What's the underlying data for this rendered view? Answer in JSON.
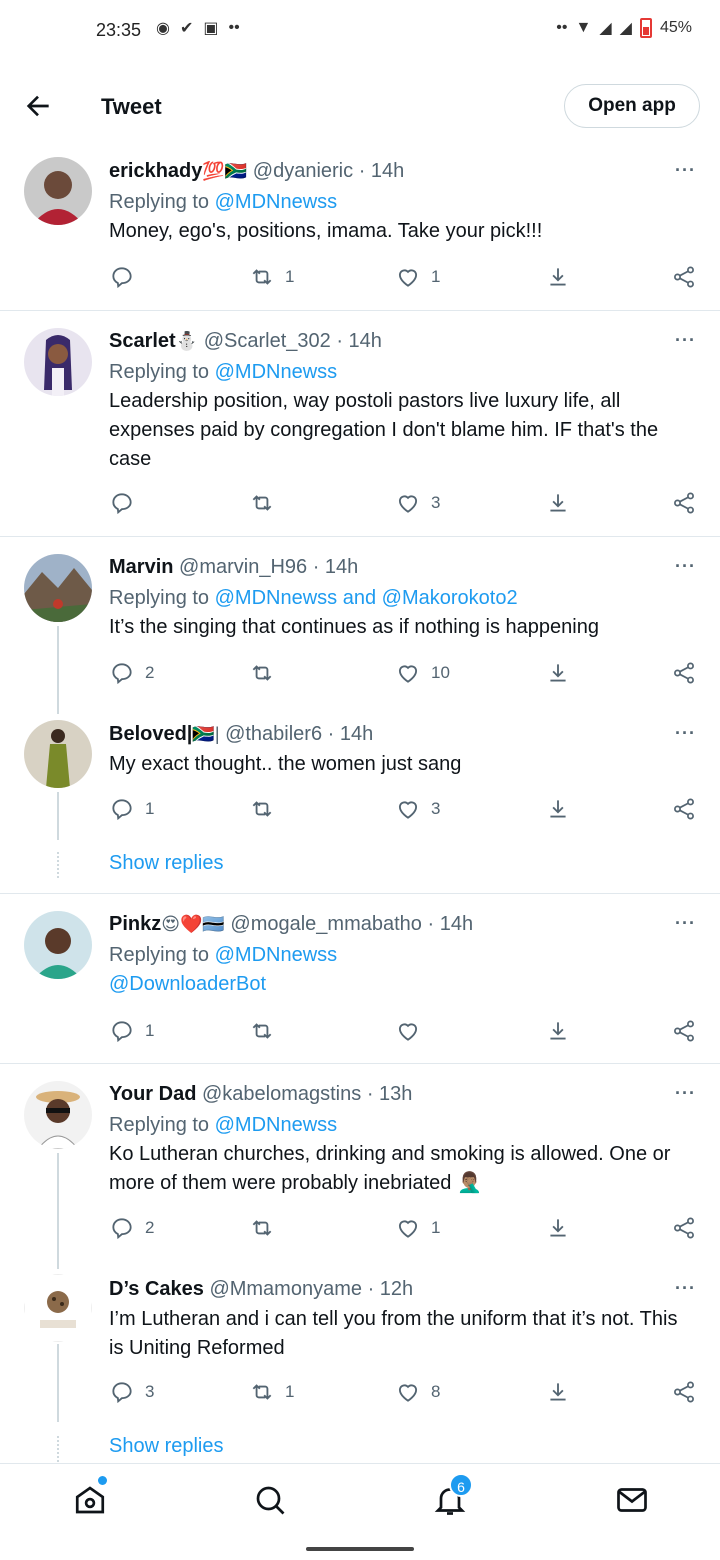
{
  "status_bar": {
    "time": "23:35",
    "battery": "45%"
  },
  "header": {
    "title": "Tweet",
    "open_app": "Open app"
  },
  "tweets": [
    {
      "name": "erickhady",
      "badge": "💯🇿🇦",
      "handle": "@dyanieric",
      "time": "· 14h",
      "reply_prefix": "Replying to",
      "reply_to": "@MDNnewss",
      "text": "Money, ego's,  positions, imama. Take your pick!!!",
      "replies": "",
      "retweets": "1",
      "likes": "1"
    },
    {
      "name": "Scarlet",
      "badge": "⛄",
      "handle": "@Scarlet_302",
      "time": "· 14h",
      "reply_prefix": "Replying to",
      "reply_to": "@MDNnewss",
      "text": "Leadership position, way postoli pastors live luxury life, all expenses paid by congregation I don't blame him. IF that's the case",
      "replies": "",
      "retweets": "",
      "likes": "3"
    },
    {
      "name": "Marvin",
      "badge": "",
      "handle": "@marvin_H96",
      "time": "· 14h",
      "reply_prefix": "Replying to",
      "reply_to": "@MDNnewss and @Makorokoto2",
      "text": "It’s the singing that continues as if nothing is happening",
      "replies": "2",
      "retweets": "",
      "likes": "10"
    },
    {
      "name": "Beloved|",
      "badge": "🇿🇦|",
      "handle": "@thabiler6",
      "time": "· 14h",
      "reply_prefix": "",
      "reply_to": "",
      "text": "My exact thought.. the women just sang",
      "replies": "1",
      "retweets": "",
      "likes": "3"
    },
    {
      "name": "Pinkz",
      "badge": "😍❤️🇧🇼",
      "handle": "@mogale_mmabatho",
      "time": "· 14h",
      "reply_prefix": "Replying to",
      "reply_to": "@MDNnewss",
      "text": "@DownloaderBot",
      "replies": "1",
      "retweets": "",
      "likes": ""
    },
    {
      "name": "Your Dad",
      "badge": "",
      "handle": "@kabelomagstins",
      "time": "· 13h",
      "reply_prefix": "Replying to",
      "reply_to": "@MDNnewss",
      "text": "Ko Lutheran churches, drinking and smoking is allowed. One or more of them were probably inebriated 🤦🏽‍♂️",
      "replies": "2",
      "retweets": "",
      "likes": "1"
    },
    {
      "name": "D’s Cakes",
      "badge": "",
      "handle": "@Mmamonyame",
      "time": "· 12h",
      "reply_prefix": "",
      "reply_to": "",
      "text": "I’m Lutheran and i can tell you from the uniform that it’s not. This is Uniting Reformed",
      "replies": "3",
      "retweets": "1",
      "likes": "8"
    }
  ],
  "show_replies": "Show replies",
  "more_label": "···",
  "nav": {
    "notifications_badge": "6"
  },
  "icons": [
    "back-arrow-icon",
    "reply-icon",
    "retweet-icon",
    "like-icon",
    "share-icon",
    "analytics-icon",
    "home-icon",
    "search-icon",
    "bell-icon",
    "mail-icon"
  ],
  "colors": {
    "accent": "#1d9bf0",
    "text": "#0f1419",
    "muted": "#536471"
  }
}
